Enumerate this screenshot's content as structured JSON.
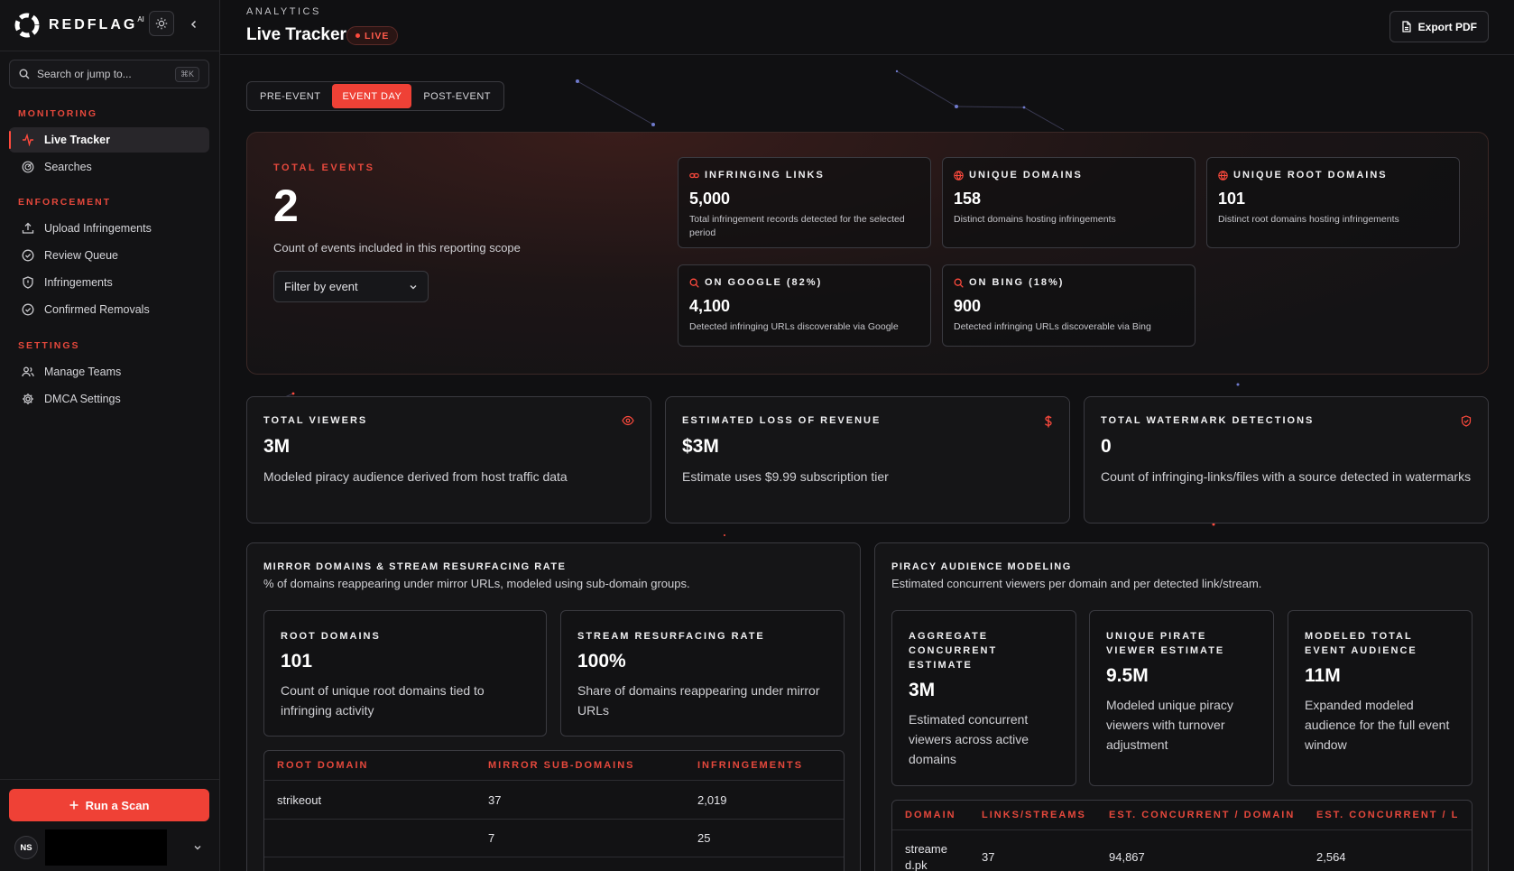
{
  "brand": {
    "name": "REDFLAG",
    "suffix": "AI"
  },
  "search": {
    "placeholder": "Search or jump to...",
    "shortcut": "⌘K"
  },
  "sidebar": {
    "sections": [
      {
        "title": "MONITORING",
        "items": [
          {
            "label": "Live Tracker",
            "icon": "activity-icon",
            "active": true
          },
          {
            "label": "Searches",
            "icon": "radar-icon"
          }
        ]
      },
      {
        "title": "ENFORCEMENT",
        "items": [
          {
            "label": "Upload Infringements",
            "icon": "upload-icon"
          },
          {
            "label": "Review Queue",
            "icon": "check-circle-icon"
          },
          {
            "label": "Infringements",
            "icon": "shield-alert-icon"
          },
          {
            "label": "Confirmed Removals",
            "icon": "check-circle-icon"
          }
        ]
      },
      {
        "title": "SETTINGS",
        "items": [
          {
            "label": "Manage Teams",
            "icon": "users-icon"
          },
          {
            "label": "DMCA Settings",
            "icon": "gear-icon"
          }
        ]
      }
    ],
    "run_scan_label": "Run a Scan",
    "user_initials": "NS"
  },
  "header": {
    "kicker": "ANALYTICS",
    "title": "Live Tracker",
    "live_label": "LIVE",
    "export_label": "Export PDF"
  },
  "tabs": [
    "PRE-EVENT",
    "EVENT DAY",
    "POST-EVENT"
  ],
  "active_tab": "EVENT DAY",
  "hero": {
    "label": "TOTAL EVENTS",
    "value": "2",
    "description": "Count of events included in this reporting scope",
    "filter_label": "Filter by event",
    "cards": [
      {
        "title": "INFRINGING LINKS",
        "icon": "link-icon",
        "value": "5,000",
        "desc": "Total infringement records detected for the selected period"
      },
      {
        "title": "UNIQUE DOMAINS",
        "icon": "globe-icon",
        "value": "158",
        "desc": "Distinct domains hosting infringements"
      },
      {
        "title": "UNIQUE ROOT DOMAINS",
        "icon": "globe-icon",
        "value": "101",
        "desc": "Distinct root domains hosting infringements"
      },
      {
        "title": "ON GOOGLE (82%)",
        "icon": "search-icon",
        "value": "4,100",
        "desc": "Detected infringing URLs discoverable via Google"
      },
      {
        "title": "ON BING (18%)",
        "icon": "search-icon",
        "value": "900",
        "desc": "Detected infringing URLs discoverable via Bing"
      }
    ]
  },
  "stats": [
    {
      "title": "TOTAL VIEWERS",
      "icon": "eye-icon",
      "value": "3M",
      "desc": "Modeled piracy audience derived from host traffic data"
    },
    {
      "title": "ESTIMATED LOSS OF REVENUE",
      "icon": "dollar-icon",
      "value": "$3M",
      "desc": "Estimate uses $9.99 subscription tier"
    },
    {
      "title": "TOTAL WATERMARK DETECTIONS",
      "icon": "shield-check-icon",
      "value": "0",
      "desc": "Count of infringing-links/files with a source detected in watermarks"
    }
  ],
  "mirror": {
    "title": "MIRROR DOMAINS & STREAM RESURFACING RATE",
    "subtitle": "% of domains reappearing under mirror URLs, modeled using sub-domain groups.",
    "kpis": [
      {
        "title": "ROOT DOMAINS",
        "value": "101",
        "desc": "Count of unique root domains tied to infringing activity"
      },
      {
        "title": "STREAM RESURFACING RATE",
        "value": "100%",
        "desc": "Share of domains reappearing under mirror URLs"
      }
    ],
    "columns": [
      "ROOT DOMAIN",
      "MIRROR SUB-DOMAINS",
      "INFRINGEMENTS"
    ],
    "rows": [
      [
        "strikeout",
        "37",
        "2,019"
      ],
      [
        "",
        "7",
        "25"
      ]
    ]
  },
  "audience": {
    "title": "PIRACY AUDIENCE MODELING",
    "subtitle": "Estimated concurrent viewers per domain and per detected link/stream.",
    "kpis": [
      {
        "title": "AGGREGATE CONCURRENT ESTIMATE",
        "value": "3M",
        "desc": "Estimated concurrent viewers across active domains"
      },
      {
        "title": "UNIQUE PIRATE VIEWER ESTIMATE",
        "value": "9.5M",
        "desc": "Modeled unique piracy viewers with turnover adjustment"
      },
      {
        "title": "MODELED TOTAL EVENT AUDIENCE",
        "value": "11M",
        "desc": "Expanded modeled audience for the full event window"
      }
    ],
    "columns": [
      "DOMAIN",
      "LINKS/STREAMS",
      "EST. CONCURRENT / DOMAIN",
      "EST. CONCURRENT / LINK"
    ],
    "rows": [
      [
        "streamed.pk",
        "37",
        "94,867",
        "2,564"
      ]
    ]
  },
  "colors": {
    "accent": "#ef4136",
    "background": "#101012",
    "surface": "#151517"
  }
}
